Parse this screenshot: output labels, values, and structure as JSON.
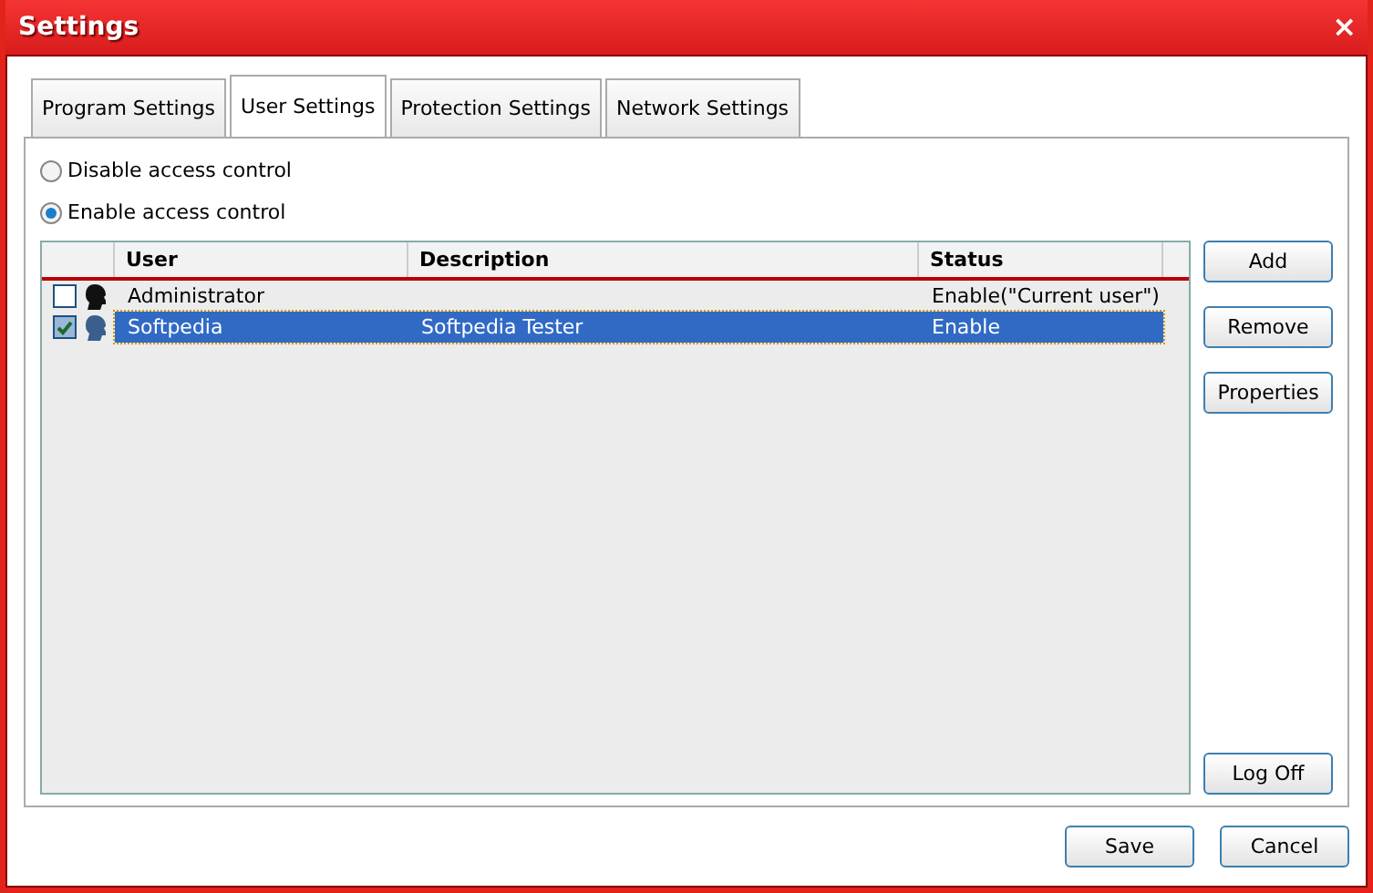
{
  "window": {
    "title": "Settings",
    "close": "×"
  },
  "tabs": [
    {
      "label": "Program Settings",
      "selected": false
    },
    {
      "label": "User Settings",
      "selected": true
    },
    {
      "label": "Protection Settings",
      "selected": false
    },
    {
      "label": "Network Settings",
      "selected": false
    }
  ],
  "access_options": [
    {
      "label": "Disable access control",
      "selected": false
    },
    {
      "label": "Enable access control",
      "selected": true
    }
  ],
  "table": {
    "columns": [
      "User",
      "Description",
      "Status"
    ],
    "rows": [
      {
        "checked": false,
        "selected": false,
        "cells": [
          "Administrator",
          "",
          "Enable(\"Current user\")"
        ]
      },
      {
        "checked": true,
        "selected": true,
        "cells": [
          "Softpedia",
          "Softpedia Tester",
          "Enable"
        ]
      }
    ]
  },
  "side_buttons": [
    "Add",
    "Remove",
    "Properties"
  ],
  "logoff_button": "Log Off",
  "footer_buttons": [
    "Save",
    "Cancel"
  ]
}
